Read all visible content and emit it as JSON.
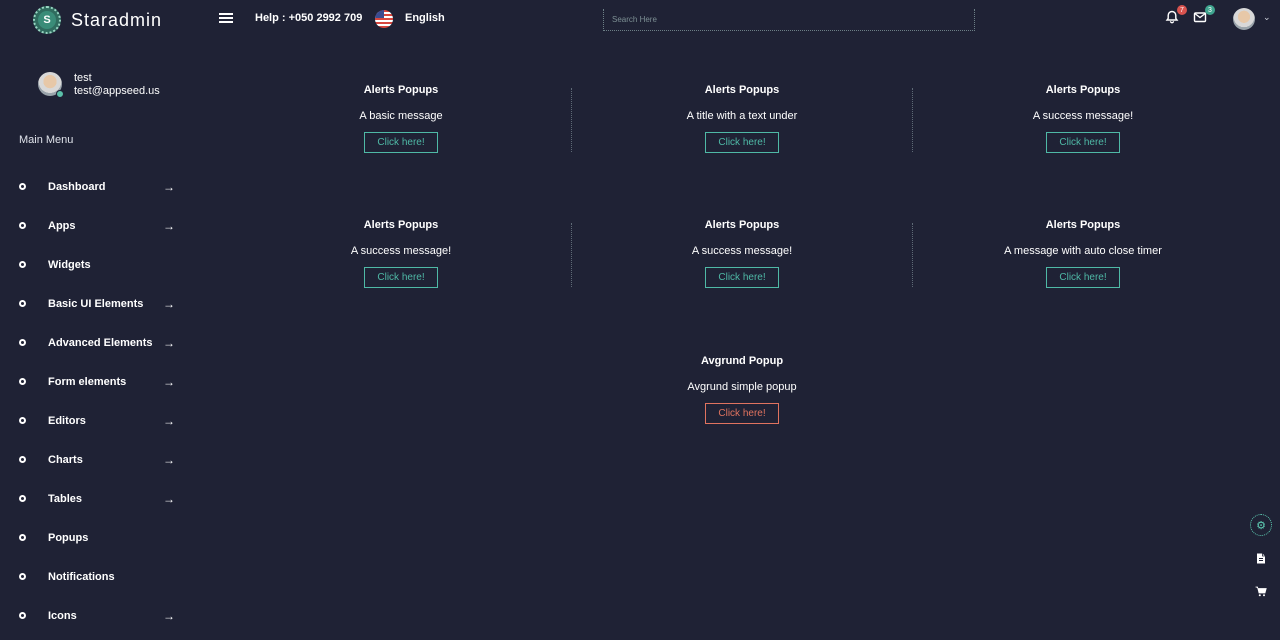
{
  "brand": {
    "logo_letter": "S",
    "name": "Staradmin"
  },
  "topbar": {
    "help": "Help : +050 2992 709",
    "language": "English",
    "search_placeholder": "Search Here",
    "notifications_count": "7",
    "messages_count": "3",
    "colors": {
      "notification_badge": "#d9534f",
      "message_badge": "#3fa58f"
    }
  },
  "profile": {
    "name": "test",
    "email": "test@appseed.us"
  },
  "sidebar": {
    "menu_title": "Main Menu",
    "items": [
      {
        "label": "Dashboard",
        "has_arrow": true
      },
      {
        "label": "Apps",
        "has_arrow": true
      },
      {
        "label": "Widgets",
        "has_arrow": false
      },
      {
        "label": "Basic UI Elements",
        "has_arrow": true
      },
      {
        "label": "Advanced Elements",
        "has_arrow": true
      },
      {
        "label": "Form elements",
        "has_arrow": true
      },
      {
        "label": "Editors",
        "has_arrow": true
      },
      {
        "label": "Charts",
        "has_arrow": true
      },
      {
        "label": "Tables",
        "has_arrow": true
      },
      {
        "label": "Popups",
        "has_arrow": false
      },
      {
        "label": "Notifications",
        "has_arrow": false
      },
      {
        "label": "Icons",
        "has_arrow": true
      }
    ]
  },
  "cards": [
    {
      "title": "Alerts Popups",
      "text": "A basic message",
      "button": "Click here!"
    },
    {
      "title": "Alerts Popups",
      "text": "A title with a text under",
      "button": "Click here!"
    },
    {
      "title": "Alerts Popups",
      "text": "A success message!",
      "button": "Click here!"
    },
    {
      "title": "Alerts Popups",
      "text": "A success message!",
      "button": "Click here!"
    },
    {
      "title": "Alerts Popups",
      "text": "A success message!",
      "button": "Click here!"
    },
    {
      "title": "Alerts Popups",
      "text": "A message with auto close timer",
      "button": "Click here!"
    },
    {
      "title": "Avgrund Popup",
      "text": "Avgrund simple popup",
      "button": "Click here!"
    }
  ],
  "colors": {
    "background": "#1f2235",
    "accent": "#4fb9a6",
    "danger": "#e0735f"
  }
}
